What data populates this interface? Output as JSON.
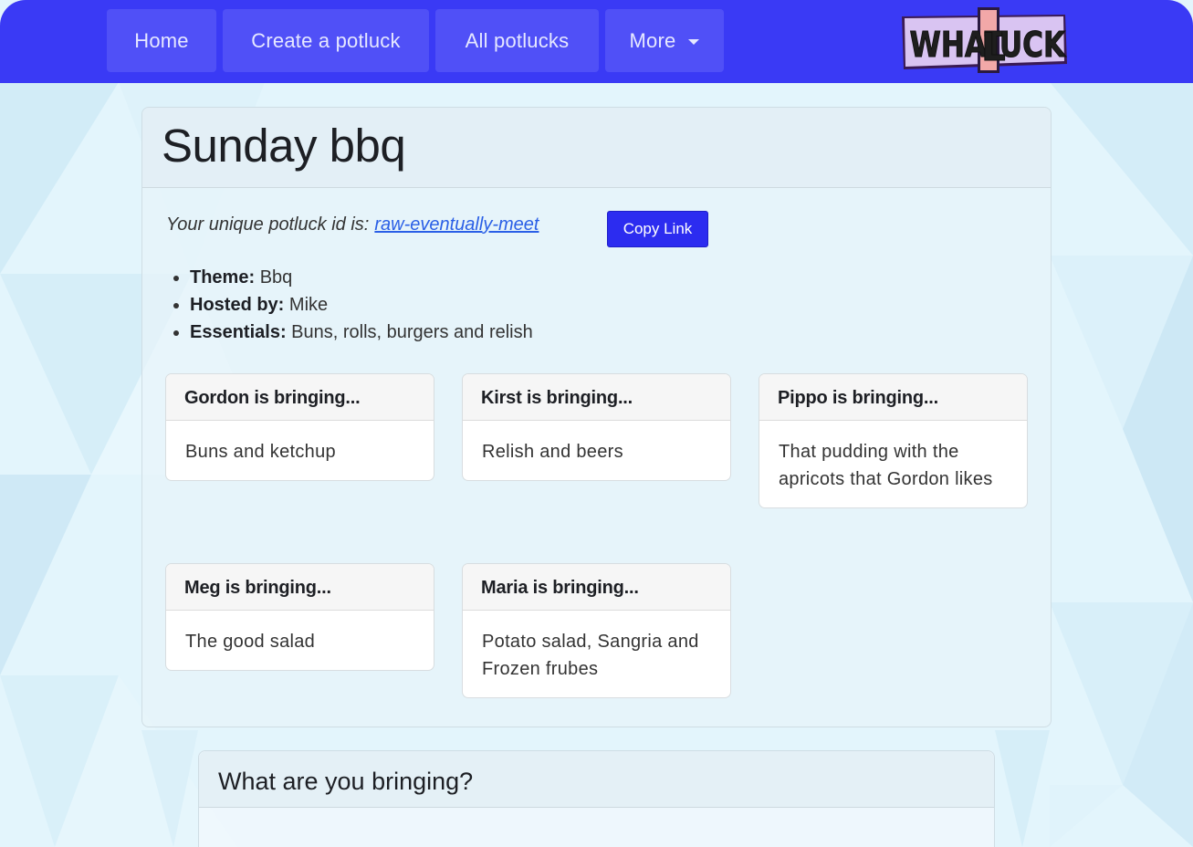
{
  "nav": {
    "items": [
      {
        "label": "Home"
      },
      {
        "label": "Create a potluck"
      },
      {
        "label": "All potlucks"
      },
      {
        "label": "More"
      }
    ],
    "logo_text": "WHATLUCK"
  },
  "potluck": {
    "title": "Sunday bbq",
    "id_prefix": "Your unique potluck id is:",
    "id": "raw-eventually-meet",
    "copy_label": "Copy Link",
    "details": [
      {
        "key": "Theme:",
        "value": "Bbq"
      },
      {
        "key": "Hosted by:",
        "value": "Mike"
      },
      {
        "key": "Essentials:",
        "value": "Buns, rolls, burgers and relish"
      }
    ],
    "contributions": [
      {
        "heading": "Gordon is bringing...",
        "item": "Buns and ketchup"
      },
      {
        "heading": "Kirst is bringing...",
        "item": "Relish and beers"
      },
      {
        "heading": "Pippo is bringing...",
        "item": "That pudding with the apricots that Gordon likes"
      },
      {
        "heading": "Meg is bringing...",
        "item": "The good salad"
      },
      {
        "heading": "Maria is bringing...",
        "item": "Potato salad, Sangria and Frozen frubes"
      }
    ]
  },
  "form": {
    "title": "What are you bringing?"
  },
  "colors": {
    "navbar": "#3a3af5",
    "nav_button": "#5050f7",
    "copy_button": "#2c2cf0",
    "link": "#2a5fe6"
  }
}
